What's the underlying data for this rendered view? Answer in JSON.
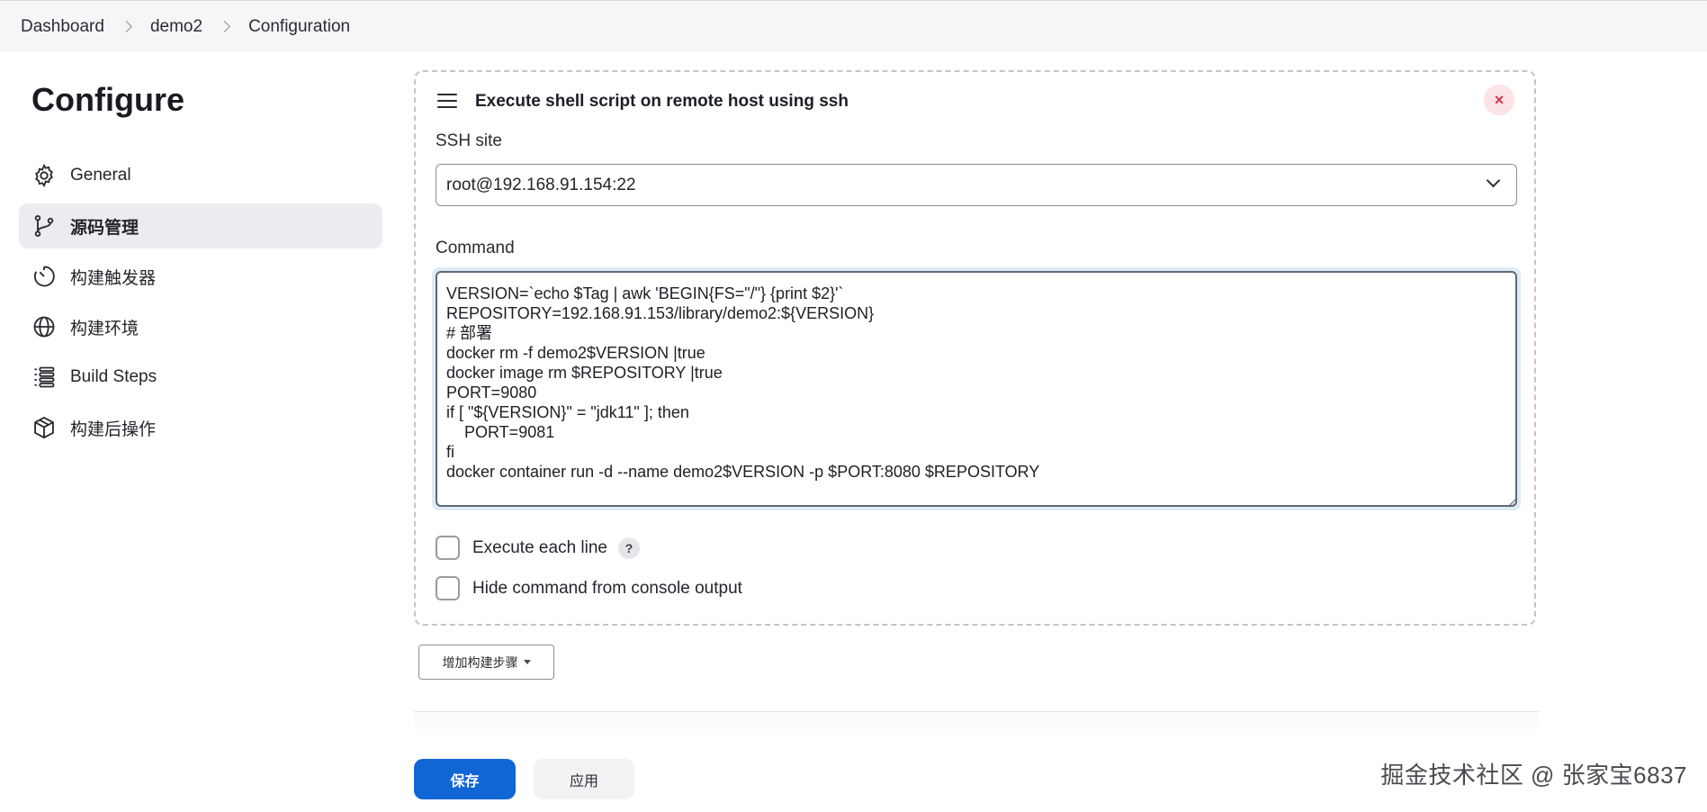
{
  "breadcrumb": [
    "Dashboard",
    "demo2",
    "Configuration"
  ],
  "page_title": "Configure",
  "sidebar": {
    "items": [
      {
        "label": "General",
        "icon": "gear-icon"
      },
      {
        "label": "源码管理",
        "icon": "branch-icon",
        "active": true
      },
      {
        "label": "构建触发器",
        "icon": "clock-icon"
      },
      {
        "label": "构建环境",
        "icon": "globe-icon"
      },
      {
        "label": "Build Steps",
        "icon": "list-icon"
      },
      {
        "label": "构建后操作",
        "icon": "cube-icon"
      }
    ]
  },
  "step": {
    "title": "Execute shell script on remote host using ssh",
    "close_label": "×",
    "ssh_site_label": "SSH site",
    "ssh_site_value": "root@192.168.91.154:22",
    "command_label": "Command",
    "command_value": "VERSION=`echo $Tag | awk 'BEGIN{FS=\"/\"} {print $2}'`\nREPOSITORY=192.168.91.153/library/demo2:${VERSION}\n# 部署\ndocker rm -f demo2$VERSION |true\ndocker image rm $REPOSITORY |true\nPORT=9080\nif [ \"${VERSION}\" = \"jdk11\" ]; then\n    PORT=9081\nfi\ndocker container run -d --name demo2$VERSION -p $PORT:8080 $REPOSITORY",
    "execute_each_line_label": "Execute each line",
    "help_label": "?",
    "hide_command_label": "Hide command from console output"
  },
  "add_step_label": "增加构建步骤",
  "save_label": "保存",
  "apply_label": "应用",
  "watermark": "掘金技术社区 @ 张家宝6837",
  "colors": {
    "primary": "#1166d6",
    "close_bg": "#fbe3e6",
    "close_fg": "#d9364f",
    "active_nav_bg": "#ececf0"
  }
}
